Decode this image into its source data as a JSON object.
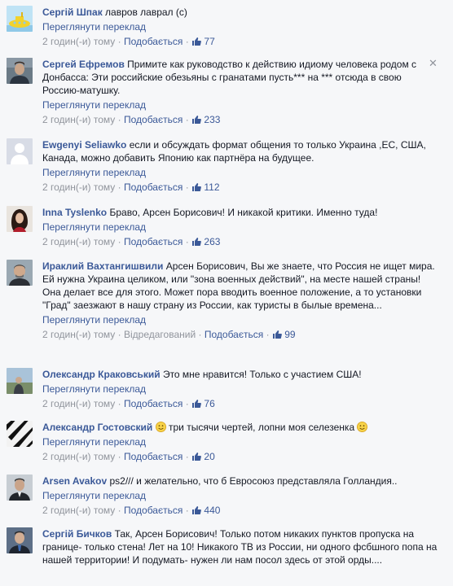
{
  "labels": {
    "see_translation": "Переглянути переклад",
    "like": "Подобається",
    "edited": "Відредагований",
    "sep": "·"
  },
  "comments": [
    {
      "author": "Сергій Шпак",
      "text": "лавров лаврал (с)",
      "time": "2 годин(-и) тому",
      "likes": "77"
    },
    {
      "author": "Сергей Ефремов",
      "text": "Примите как руководство к действию идиому человека родом с Донбасса: Эти российские обезьяны с гранатами пусть*** на *** отсюда в свою Россию-матушку.",
      "time": "2 годин(-и) тому",
      "likes": "233"
    },
    {
      "author": "Ewgenyi Seliawko",
      "text": "если и обсуждать формат общения то только Украина ,ЕС, США, Канада, можно добавить Японию как партнёра на будущее.",
      "time": "2 годин(-и) тому",
      "likes": "112"
    },
    {
      "author": "Inna Tyslenko",
      "text": "Браво, Арсен Борисович! И никакой критики. Именно туда!",
      "time": "2 годин(-и) тому",
      "likes": "263"
    },
    {
      "author": "Ираклий Вахтангишвили",
      "text": "Арсен Борисович, Вы же знаете, что Россия не ищет мира. Ей нужна Украина целиком, или \"зона военных действий\", на месте нашей страны! Она делает все для этого. Может пора вводить военное положение, а то установки \"Град\" заезжают в нашу страну из России, как туристы в былые времена...",
      "time": "2 годин(-и) тому",
      "likes": "99"
    },
    {
      "author": "Олександр Краковський",
      "text": "Это мне нравится! Только с участием США!",
      "time": "2 годин(-и) тому",
      "likes": "76"
    },
    {
      "author": "Александр Гостовский",
      "text": "три тысячи чертей, лопни моя селезенка",
      "time": "2 годин(-и) тому",
      "likes": "20"
    },
    {
      "author": "Arsen Avakov",
      "text": "ps2/// и желательно, что б Евросоюз представляла Голландия..",
      "time": "2 годин(-и) тому",
      "likes": "440"
    },
    {
      "author": "Сергій Бичков",
      "text": "Так, Арсен Борисович! Только потом никаких пунктов пропуска на границе- только стена! Лет на 10! Никакого ТВ из России, ни одного фсбшного попа на нашей территории! И подумать- нужен ли нам посол здесь от этой орды...."
    }
  ],
  "colors": {
    "link": "#3b5998",
    "meta": "#90949c",
    "bg": "#f6f7f9",
    "text": "#141823"
  },
  "icons": {
    "like": "thumbs-up-icon",
    "close": "close-icon",
    "emoji": "smiley-icon"
  }
}
